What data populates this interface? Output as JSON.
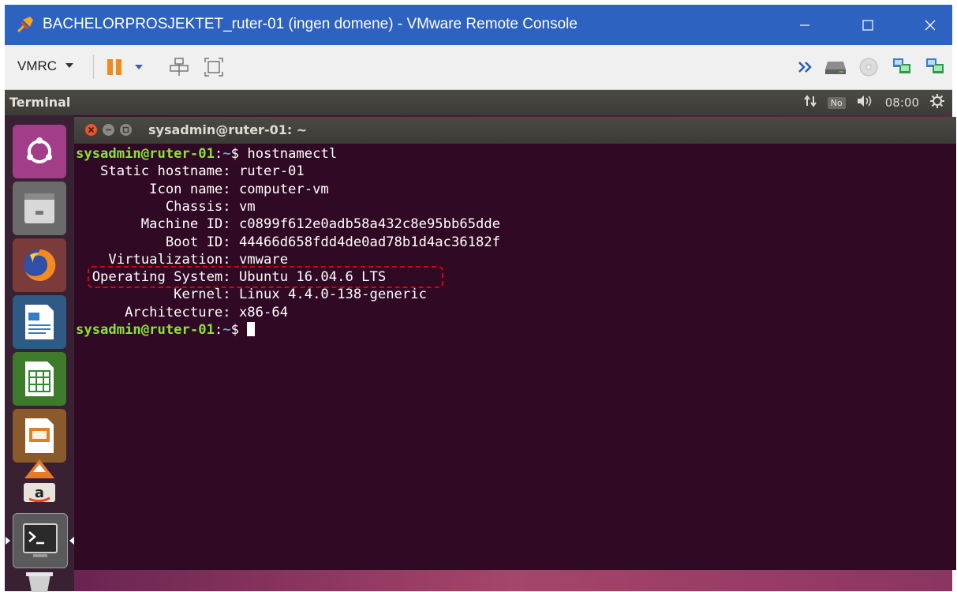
{
  "window": {
    "title": "BACHELORPROSJEKTET_ruter-01 (ingen domene) - VMware Remote Console",
    "app_icon": "vmrc-pin-icon",
    "controls": [
      "minimize-icon",
      "maximize-icon",
      "close-icon"
    ],
    "titlebar_color": "#2d62c0"
  },
  "toolbar": {
    "vmrc_menu_label": "VMRC",
    "left_icons": [
      "pause-icon",
      "dropdown-arrow-icon",
      "network-devices-icon",
      "fullscreen-icon"
    ],
    "right_icons": [
      "more-chevron-icon",
      "hard-disk-icon",
      "cd-rom-icon",
      "network-adapter-icon",
      "network-adapter-2-icon"
    ]
  },
  "ubuntu_panel": {
    "app_title": "Terminal",
    "keyboard_indicator": "No",
    "clock": "08:00",
    "icons": [
      "network-arrows-icon",
      "volume-icon",
      "power-gear-icon"
    ]
  },
  "launcher": {
    "items": [
      "ubuntu-dash-icon",
      "files-icon",
      "firefox-icon",
      "writer-icon",
      "calc-icon",
      "impress-icon",
      "software-center-icon",
      "amazon-icon",
      "terminal-icon",
      "trash-icon"
    ]
  },
  "terminal": {
    "title": "sysadmin@ruter-01: ~",
    "prompt_user_host": "sysadmin@ruter-01",
    "prompt_sep": ":",
    "prompt_path": "~",
    "prompt_end": "$ ",
    "command": "hostnamectl",
    "output": [
      "   Static hostname: ruter-01",
      "         Icon name: computer-vm",
      "           Chassis: vm",
      "        Machine ID: c0899f612e0adb58a432c8e95bb65dde",
      "           Boot ID: 44466d658fdd4de0ad78b1d4ac36182f",
      "    Virtualization: vmware",
      "  Operating System: Ubuntu 16.04.6 LTS",
      "            Kernel: Linux 4.4.0-138-generic",
      "      Architecture: x86-64"
    ],
    "highlighted_line": "Operating System: Ubuntu 16.04.6 LTS",
    "colors": {
      "background": "#300a24",
      "prompt": "#8ae234",
      "path": "#729fcf",
      "highlight": "#e00000"
    }
  }
}
